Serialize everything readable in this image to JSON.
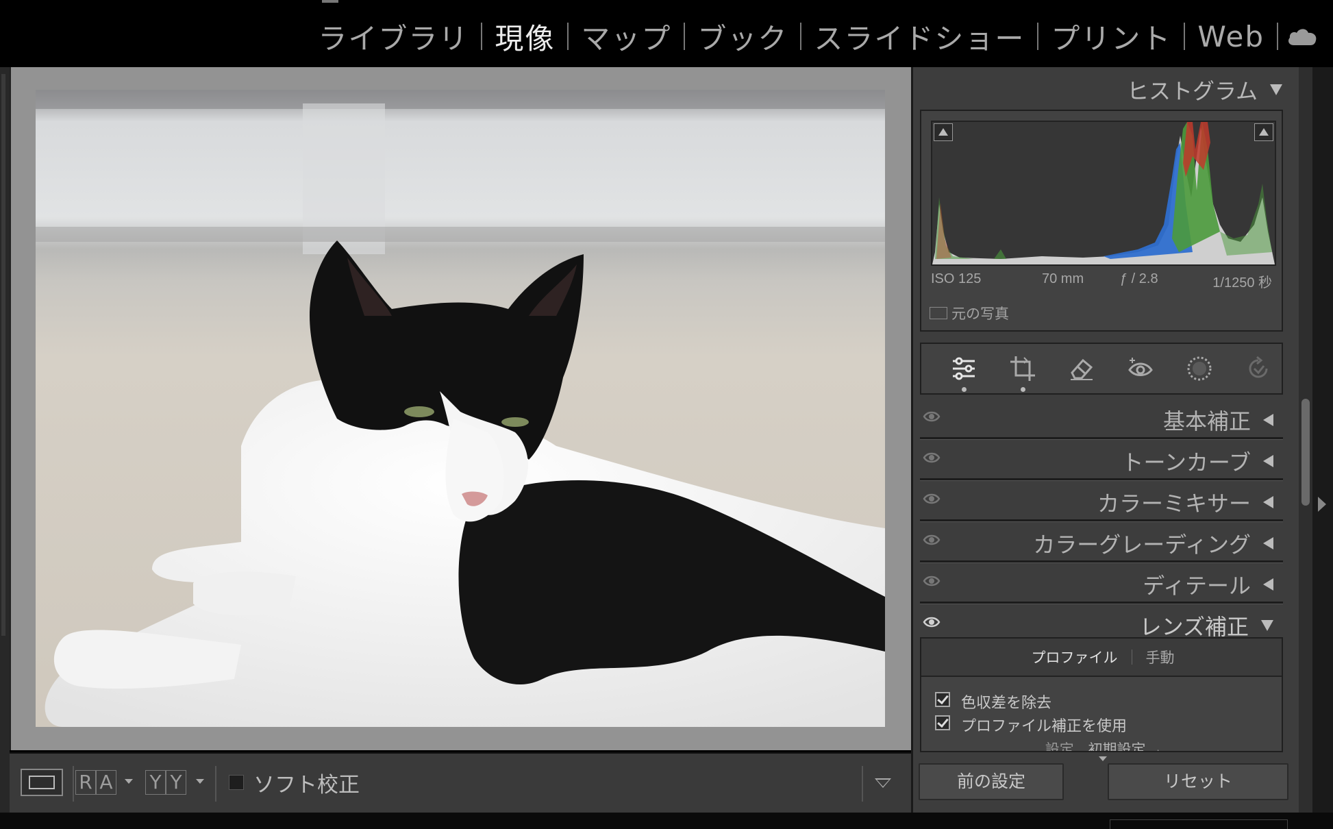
{
  "modules": [
    {
      "label": "ライブラリ",
      "active": false
    },
    {
      "label": "現像",
      "active": true
    },
    {
      "label": "マップ",
      "active": false
    },
    {
      "label": "ブック",
      "active": false
    },
    {
      "label": "スライドショー",
      "active": false
    },
    {
      "label": "プリント",
      "active": false
    },
    {
      "label": "Web",
      "active": false
    }
  ],
  "cloud_icon": "cloud-icon",
  "viewer": {
    "photo_subject": "cat-photo"
  },
  "toolbar": {
    "view_mode_icon": "loupe-view-icon",
    "flag_letters": [
      "R",
      "A"
    ],
    "before_after_letters": [
      "Y",
      "Y"
    ],
    "softproof_label": "ソフト校正",
    "softproof_checked": false
  },
  "panel": {
    "histogram": {
      "title": "ヒストグラム",
      "iso": "ISO 125",
      "focal_length": "70 mm",
      "aperture": "ƒ / 2.8",
      "shutter": "1/1250 秒",
      "original_photo_label": "元の写真",
      "colors": {
        "red": "#c0392b",
        "green": "#4b9a3c",
        "blue": "#2f6fcf",
        "gray": "#cfcfcf"
      }
    },
    "tools": [
      "edit-sliders-icon",
      "crop-icon",
      "healing-eraser-icon",
      "red-eye-icon",
      "masking-icon",
      "history-icon"
    ],
    "sections": [
      {
        "label": "基本補正",
        "expanded": false
      },
      {
        "label": "トーンカーブ",
        "expanded": false
      },
      {
        "label": "カラーミキサー",
        "expanded": false
      },
      {
        "label": "カラーグレーディング",
        "expanded": false
      },
      {
        "label": "ディテール",
        "expanded": false
      },
      {
        "label": "レンズ補正",
        "expanded": true
      }
    ],
    "lens": {
      "tabs": [
        {
          "label": "プロファイル",
          "active": true
        },
        {
          "label": "手動",
          "active": false
        }
      ],
      "remove_ca_label": "色収差を除去",
      "remove_ca_checked": true,
      "use_profile_label": "プロファイル補正を使用",
      "use_profile_checked": true,
      "setting_label": "設定",
      "setting_value": "初期設定"
    },
    "previous_button": "前の設定",
    "reset_button": "リセット"
  },
  "accent_color": "#c8c8c8"
}
